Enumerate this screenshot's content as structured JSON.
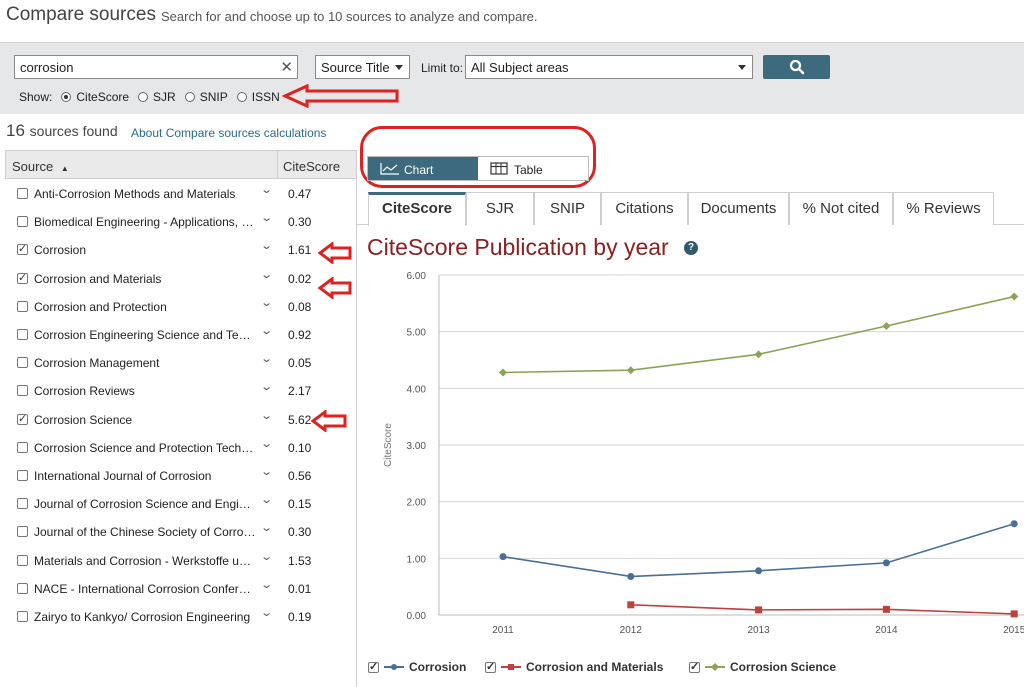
{
  "header": {
    "title": "Compare sources",
    "subtitle": "Search for and choose up to 10 sources to analyze and compare."
  },
  "search": {
    "query": "corrosion",
    "clear_icon": "close-icon",
    "field_type": "Source Title",
    "limit_label": "Limit to:",
    "subject": "All Subject areas",
    "button_icon": "search-icon"
  },
  "show": {
    "label": "Show:",
    "options": [
      "CiteScore",
      "SJR",
      "SNIP",
      "ISSN"
    ],
    "selected": "CiteScore"
  },
  "results": {
    "count": "16",
    "found_label": "sources found",
    "about_link": "About Compare sources calculations"
  },
  "list": {
    "col_source": "Source",
    "sort_indicator": "▲",
    "col_score": "CiteScore",
    "rows": [
      {
        "name": "Anti-Corrosion Methods and Materials",
        "score": "0.47",
        "checked": false
      },
      {
        "name": "Biomedical Engineering - Applications, Basis and Communications",
        "score": "0.30",
        "checked": false
      },
      {
        "name": "Corrosion",
        "score": "1.61",
        "checked": true
      },
      {
        "name": "Corrosion and Materials",
        "score": "0.02",
        "checked": true
      },
      {
        "name": "Corrosion and Protection",
        "score": "0.08",
        "checked": false
      },
      {
        "name": "Corrosion Engineering Science and Technology",
        "score": "0.92",
        "checked": false
      },
      {
        "name": "Corrosion Management",
        "score": "0.05",
        "checked": false
      },
      {
        "name": "Corrosion Reviews",
        "score": "2.17",
        "checked": false
      },
      {
        "name": "Corrosion Science",
        "score": "5.62",
        "checked": true
      },
      {
        "name": "Corrosion Science and Protection Technology",
        "score": "0.10",
        "checked": false
      },
      {
        "name": "International Journal of Corrosion",
        "score": "0.56",
        "checked": false
      },
      {
        "name": "Journal of Corrosion Science and Engineering",
        "score": "0.15",
        "checked": false
      },
      {
        "name": "Journal of the Chinese Society of Corrosion and Protection",
        "score": "0.30",
        "checked": false
      },
      {
        "name": "Materials and Corrosion - Werkstoffe und Korrosion",
        "score": "1.53",
        "checked": false
      },
      {
        "name": "NACE - International Corrosion Conference Series",
        "score": "0.01",
        "checked": false
      },
      {
        "name": "Zairyo to Kankyo/ Corrosion Engineering",
        "score": "0.19",
        "checked": false
      }
    ]
  },
  "view_toggle": {
    "chart_label": "Chart",
    "table_label": "Table",
    "selected": "Chart"
  },
  "tabs": [
    "CiteScore",
    "SJR",
    "SNIP",
    "Citations",
    "Documents",
    "% Not cited",
    "% Reviews"
  ],
  "active_tab": "CiteScore",
  "chart_title": "CiteScore Publication by year",
  "colors": {
    "accent": "#3e6a7e",
    "title": "#8b2020",
    "annotation": "#dd2222",
    "corrosion": "#4a6f96",
    "corrosion_materials": "#c0403e",
    "corrosion_science": "#8aa356"
  },
  "chart_data": {
    "type": "line",
    "title": "CiteScore Publication by year",
    "xlabel": "",
    "ylabel": "CiteScore",
    "x": [
      "2011",
      "2012",
      "2013",
      "2014",
      "2015"
    ],
    "ylim": [
      0,
      6
    ],
    "yticks": [
      "0.00",
      "1.00",
      "2.00",
      "3.00",
      "4.00",
      "5.00",
      "6.00"
    ],
    "grid": true,
    "legend_position": "bottom",
    "series": [
      {
        "name": "Corrosion",
        "values": [
          1.03,
          0.68,
          0.78,
          0.92,
          1.61
        ],
        "marker": "circle"
      },
      {
        "name": "Corrosion and Materials",
        "values": [
          null,
          0.18,
          0.09,
          0.1,
          0.02
        ],
        "marker": "square"
      },
      {
        "name": "Corrosion Science",
        "values": [
          4.28,
          4.32,
          4.6,
          5.1,
          5.62
        ],
        "marker": "diamond"
      }
    ]
  }
}
